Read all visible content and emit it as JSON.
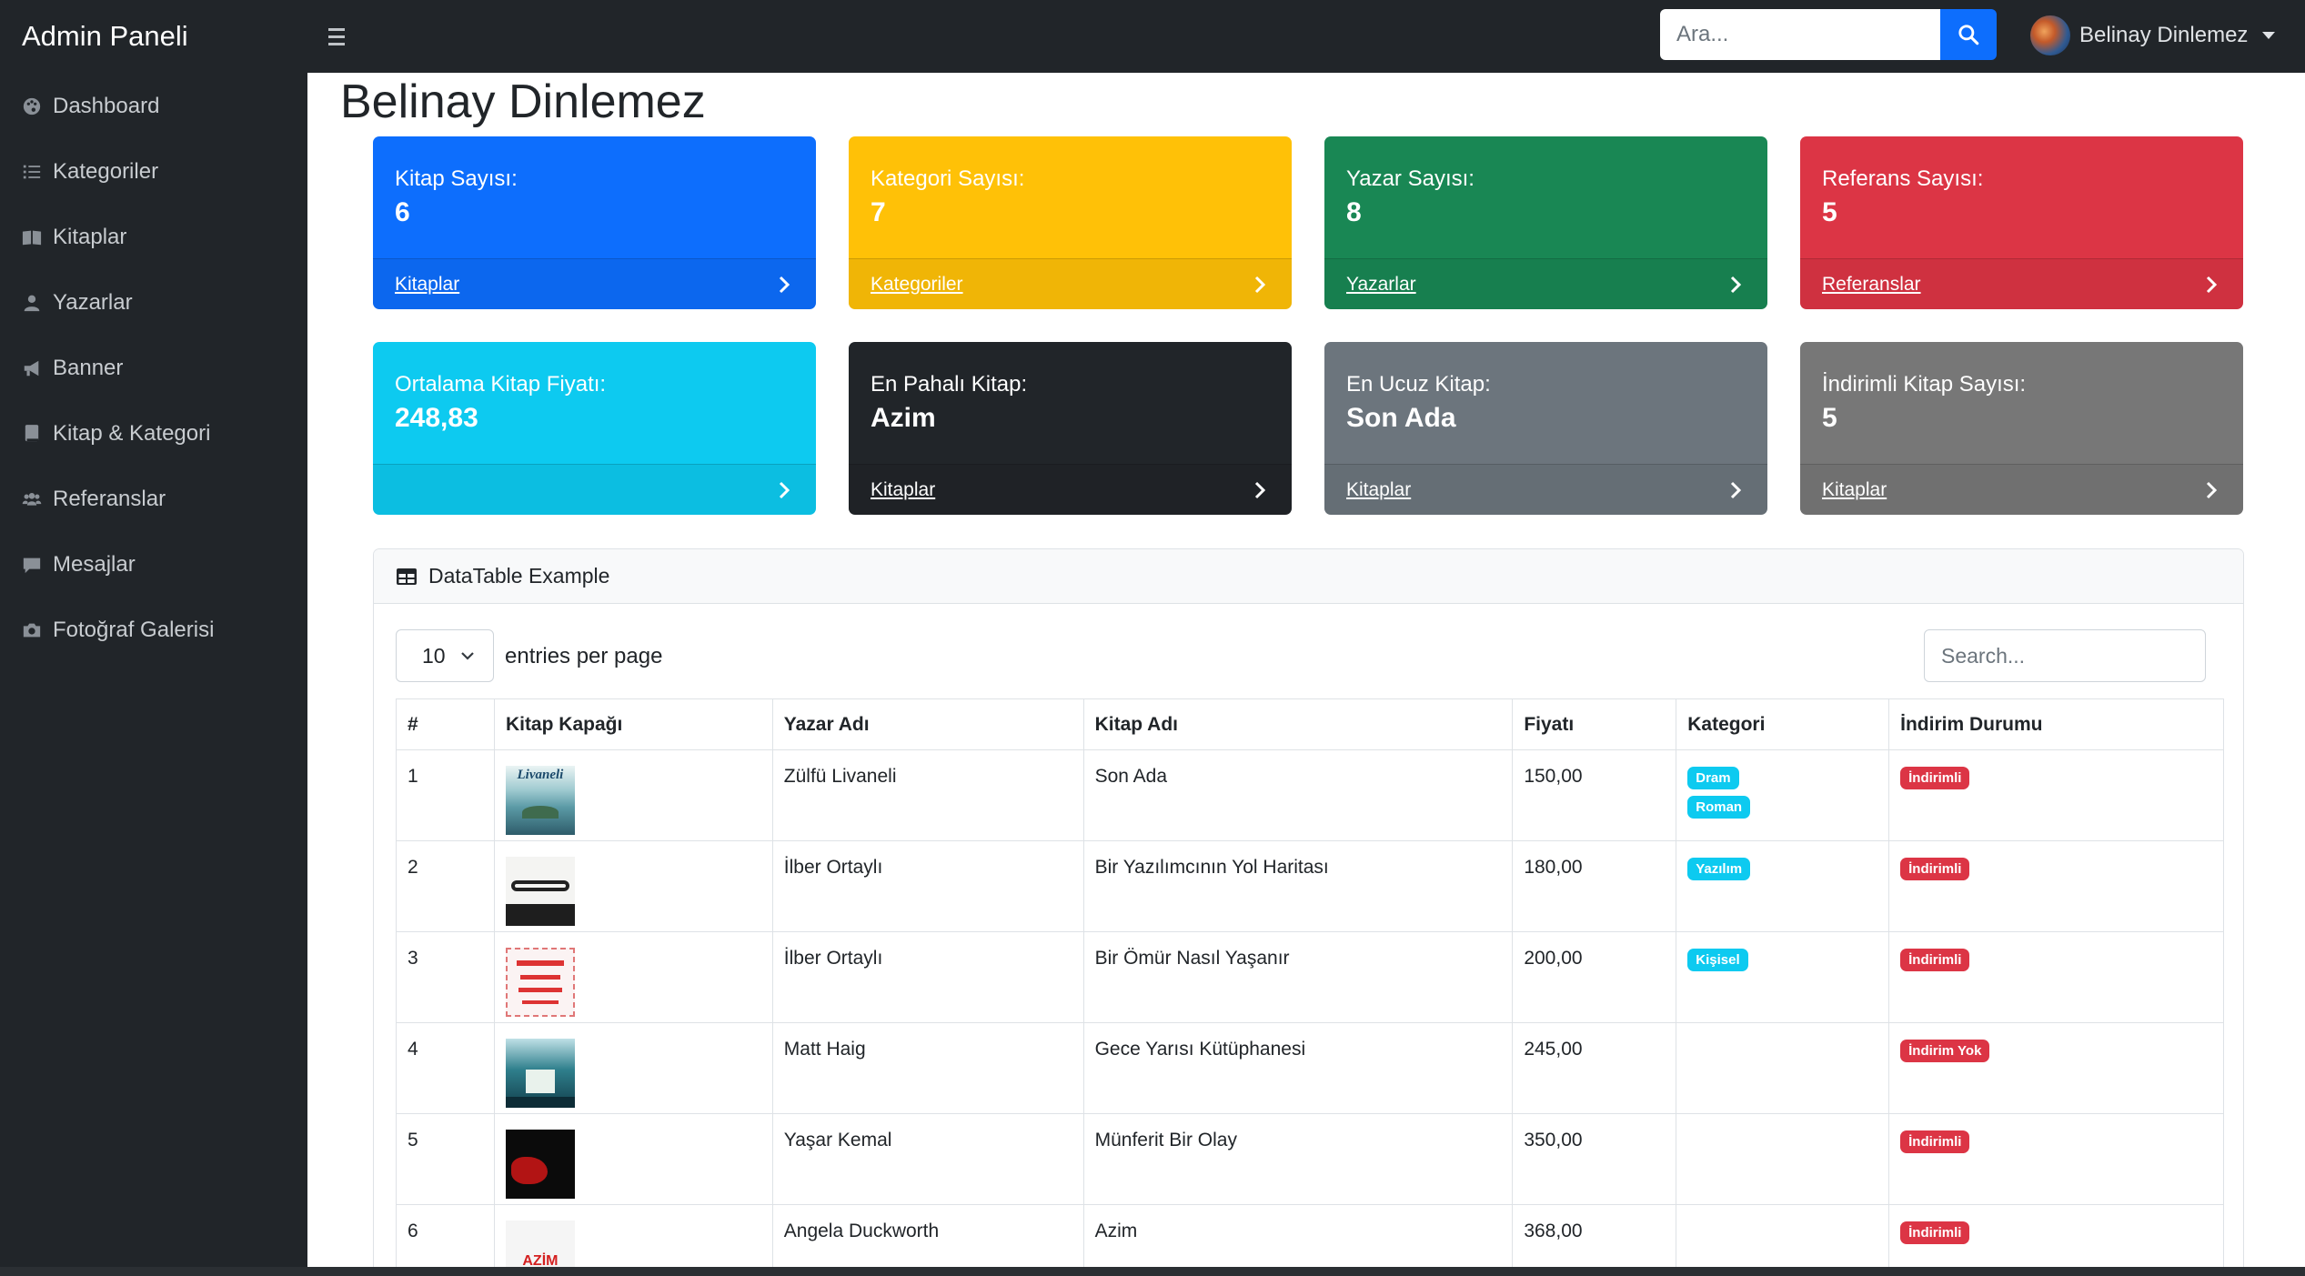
{
  "navbar": {
    "brand": "Admin Paneli",
    "search_placeholder": "Ara...",
    "user_name": "Belinay Dinlemez"
  },
  "sidebar": {
    "items": [
      {
        "label": "Dashboard",
        "icon": "palette-icon"
      },
      {
        "label": "Kategoriler",
        "icon": "list-icon"
      },
      {
        "label": "Kitaplar",
        "icon": "book-open-icon"
      },
      {
        "label": "Yazarlar",
        "icon": "user-icon"
      },
      {
        "label": "Banner",
        "icon": "bullhorn-icon"
      },
      {
        "label": "Kitap & Kategori",
        "icon": "book-icon"
      },
      {
        "label": "Referanslar",
        "icon": "users-icon"
      },
      {
        "label": "Mesajlar",
        "icon": "comment-icon"
      },
      {
        "label": "Fotoğraf Galerisi",
        "icon": "camera-icon"
      }
    ]
  },
  "page": {
    "title": "Belinay Dinlemez"
  },
  "cards": [
    {
      "label": "Kitap Sayısı:",
      "value": "6",
      "link": "Kitaplar",
      "color": "#0d6efd"
    },
    {
      "label": "Kategori Sayısı:",
      "value": "7",
      "link": "Kategoriler",
      "color": "#ffc107"
    },
    {
      "label": "Yazar Sayısı:",
      "value": "8",
      "link": "Yazarlar",
      "color": "#198754"
    },
    {
      "label": "Referans Sayısı:",
      "value": "5",
      "link": "Referanslar",
      "color": "#dc3545"
    },
    {
      "label": "Ortalama Kitap Fiyatı:",
      "value": "248,83",
      "link": "",
      "color": "#0dcaf0"
    },
    {
      "label": "En Pahalı Kitap:",
      "value": "Azim",
      "link": "Kitaplar",
      "color": "#212529"
    },
    {
      "label": "En Ucuz Kitap:",
      "value": "Son Ada",
      "link": "Kitaplar",
      "color": "#6c757d"
    },
    {
      "label": "İndirimli Kitap Sayısı:",
      "value": "5",
      "link": "Kitaplar",
      "color": "#777777"
    }
  ],
  "datatable": {
    "title": "DataTable Example",
    "page_size": "10",
    "entries_label": "entries per page",
    "search_placeholder": "Search...",
    "columns": [
      "#",
      "Kitap Kapağı",
      "Yazar Adı",
      "Kitap Adı",
      "Fiyatı",
      "Kategori",
      "İndirim Durumu"
    ],
    "rows": [
      {
        "id": "1",
        "author": "Zülfü Livaneli",
        "title": "Son Ada",
        "price": "150,00",
        "categories": [
          "Dram",
          "Roman"
        ],
        "discount": "İndirimli",
        "cover_text": "Livaneli"
      },
      {
        "id": "2",
        "author": "İlber Ortaylı",
        "title": "Bir Yazılımcının Yol Haritası",
        "price": "180,00",
        "categories": [
          "Yazılım"
        ],
        "discount": "İndirimli",
        "cover_text": ""
      },
      {
        "id": "3",
        "author": "İlber Ortaylı",
        "title": "Bir Ömür Nasıl Yaşanır",
        "price": "200,00",
        "categories": [
          "Kişisel"
        ],
        "discount": "İndirimli",
        "cover_text": ""
      },
      {
        "id": "4",
        "author": "Matt Haig",
        "title": "Gece Yarısı Kütüphanesi",
        "price": "245,00",
        "categories": [],
        "discount": "İndirim Yok",
        "cover_text": ""
      },
      {
        "id": "5",
        "author": "Yaşar Kemal",
        "title": "Münferit Bir Olay",
        "price": "350,00",
        "categories": [],
        "discount": "İndirimli",
        "cover_text": ""
      },
      {
        "id": "6",
        "author": "Angela Duckworth",
        "title": "Azim",
        "price": "368,00",
        "categories": [],
        "discount": "İndirimli",
        "cover_text": "AZİM"
      }
    ]
  },
  "colors": {
    "navbar_bg": "#212529",
    "primary": "#0d6efd",
    "info": "#0dcaf0",
    "danger": "#dc3545"
  }
}
